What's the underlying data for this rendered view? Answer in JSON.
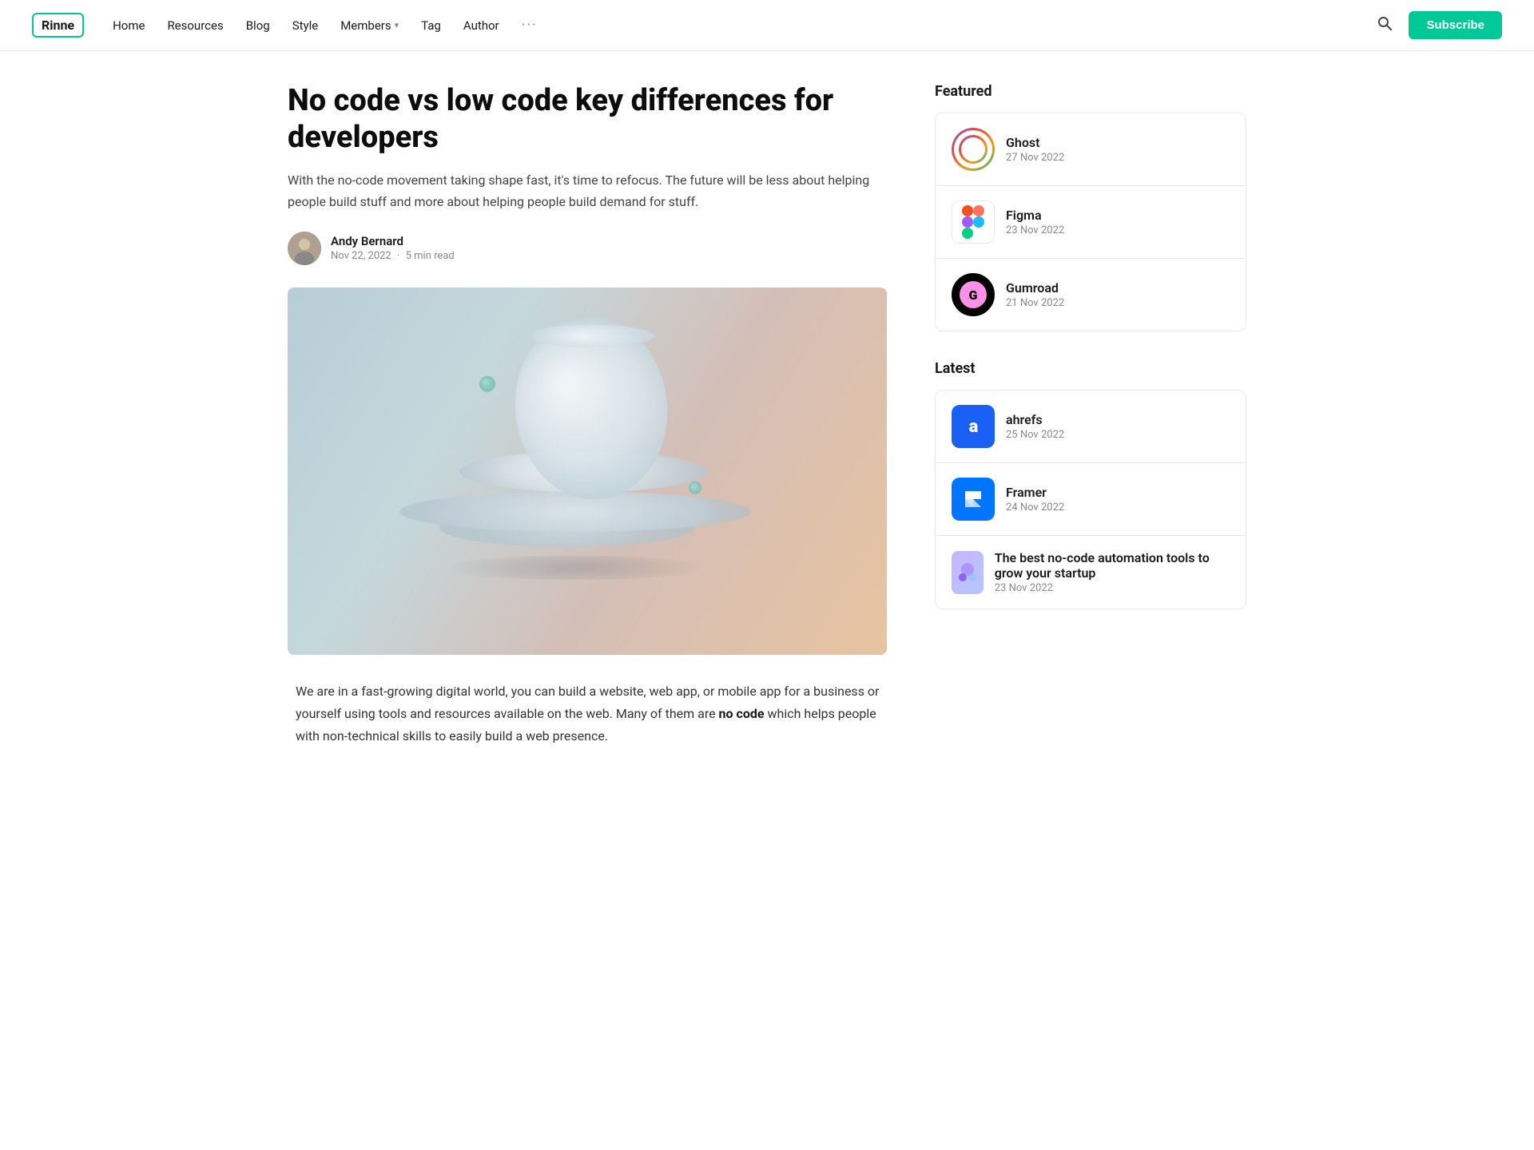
{
  "site": {
    "logo": "Rinne"
  },
  "nav": {
    "links": [
      {
        "label": "Home",
        "hasDropdown": false
      },
      {
        "label": "Resources",
        "hasDropdown": false
      },
      {
        "label": "Blog",
        "hasDropdown": false
      },
      {
        "label": "Style",
        "hasDropdown": false
      },
      {
        "label": "Members",
        "hasDropdown": true
      },
      {
        "label": "Tag",
        "hasDropdown": false
      },
      {
        "label": "Author",
        "hasDropdown": false
      }
    ],
    "more": "···",
    "subscribe": "Subscribe"
  },
  "article": {
    "title": "No code vs low code key differences for developers",
    "subtitle": "With the no-code movement taking shape fast, it's time to refocus. The future will be less about helping people build stuff and more about helping people build demand for stuff.",
    "author_name": "Andy Bernard",
    "author_date": "Nov 22, 2022",
    "read_time": "5 min read",
    "dot_sep": "·",
    "body_p1": "We are in a fast-growing digital world, you can build a website, web app, or mobile app for a business or yourself using tools and resources available on the web. Many of them are ",
    "body_bold": "no code",
    "body_p1_end": " which helps people with non-technical skills to easily build a web presence."
  },
  "sidebar": {
    "featured_label": "Featured",
    "latest_label": "Latest",
    "featured_items": [
      {
        "title": "Ghost",
        "date": "27 Nov 2022",
        "logo_type": "ghost"
      },
      {
        "title": "Figma",
        "date": "23 Nov 2022",
        "logo_type": "figma"
      },
      {
        "title": "Gumroad",
        "date": "21 Nov 2022",
        "logo_type": "gumroad"
      }
    ],
    "latest_items": [
      {
        "title": "ahrefs",
        "date": "25 Nov 2022",
        "logo_type": "ahrefs"
      },
      {
        "title": "Framer",
        "date": "24 Nov 2022",
        "logo_type": "framer"
      },
      {
        "title": "The best no-code automation tools to grow your startup",
        "date": "23 Nov 2022",
        "logo_type": "nocode"
      }
    ]
  }
}
